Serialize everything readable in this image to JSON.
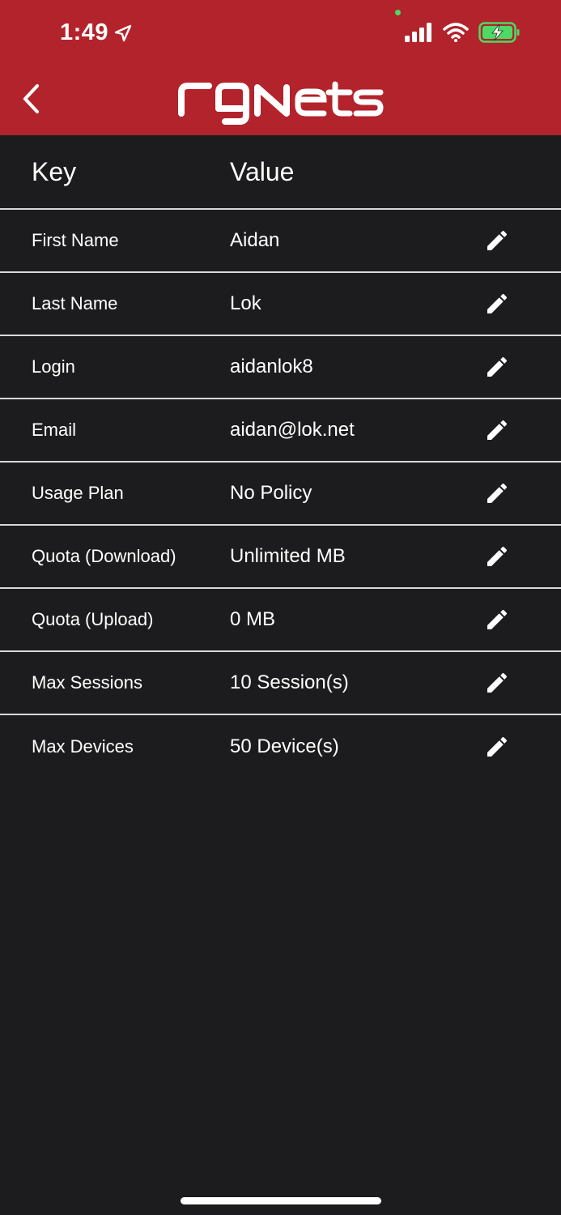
{
  "status_bar": {
    "time": "1:49"
  },
  "header": {
    "logo_text": "rgNets"
  },
  "table": {
    "key_header": "Key",
    "value_header": "Value",
    "rows": [
      {
        "key": "First Name",
        "value": "Aidan"
      },
      {
        "key": "Last Name",
        "value": "Lok"
      },
      {
        "key": "Login",
        "value": "aidanlok8"
      },
      {
        "key": "Email",
        "value": "aidan@lok.net"
      },
      {
        "key": "Usage Plan",
        "value": "No Policy"
      },
      {
        "key": "Quota (Download)",
        "value": "Unlimited MB"
      },
      {
        "key": "Quota (Upload)",
        "value": "0 MB"
      },
      {
        "key": "Max Sessions",
        "value": "10 Session(s)"
      },
      {
        "key": "Max Devices",
        "value": "50 Device(s)"
      }
    ]
  },
  "colors": {
    "header_bg": "#b3232c",
    "body_bg": "#1c1c1e",
    "divider": "#d8d8d8",
    "battery": "#4cd964"
  },
  "icons": {
    "back": "chevron-left-icon",
    "edit": "pencil-icon",
    "location": "location-arrow-icon"
  }
}
